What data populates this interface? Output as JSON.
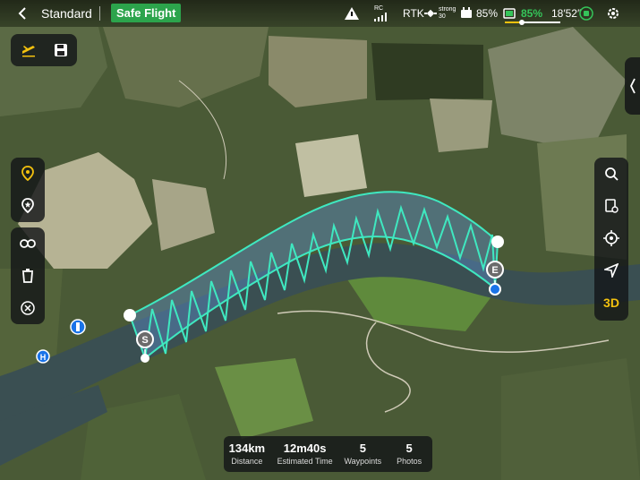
{
  "header": {
    "back_icon": "chevron-left-icon",
    "flight_mode": "Standard",
    "safety_badge": "Safe Flight",
    "rc_label": "RC",
    "rtk_label": "RTK",
    "gnss_strength": "strong",
    "gnss_count": "30",
    "remote_battery": "85%",
    "aircraft_battery": "85%",
    "flight_time_remaining": "18′52″",
    "colors": {
      "safe_green": "#2ca44c",
      "accent_yellow": "#f3c10e",
      "battery_green": "#35c55a"
    }
  },
  "left_toolbar": {
    "top_group": [
      "takeoff-icon",
      "save-icon"
    ],
    "tool_group": [
      "waypoint-pin-icon",
      "star-pin-icon"
    ],
    "edit_group": [
      "switch-direction-icon",
      "delete-icon",
      "clear-icon"
    ]
  },
  "right_toolbar": {
    "buttons": [
      "search-icon",
      "route-library-icon",
      "locate-icon",
      "navigation-icon"
    ],
    "view_toggle": "3D"
  },
  "map_markers": {
    "start_label": "S",
    "end_label": "E",
    "helipad_label": "H"
  },
  "stats": {
    "distance_value": "134km",
    "distance_label": "Distance",
    "time_value": "12m40s",
    "time_label": "Estimated Time",
    "waypoints_value": "5",
    "waypoints_label": "Waypoints",
    "photos_value": "5",
    "photos_label": "Photos"
  }
}
